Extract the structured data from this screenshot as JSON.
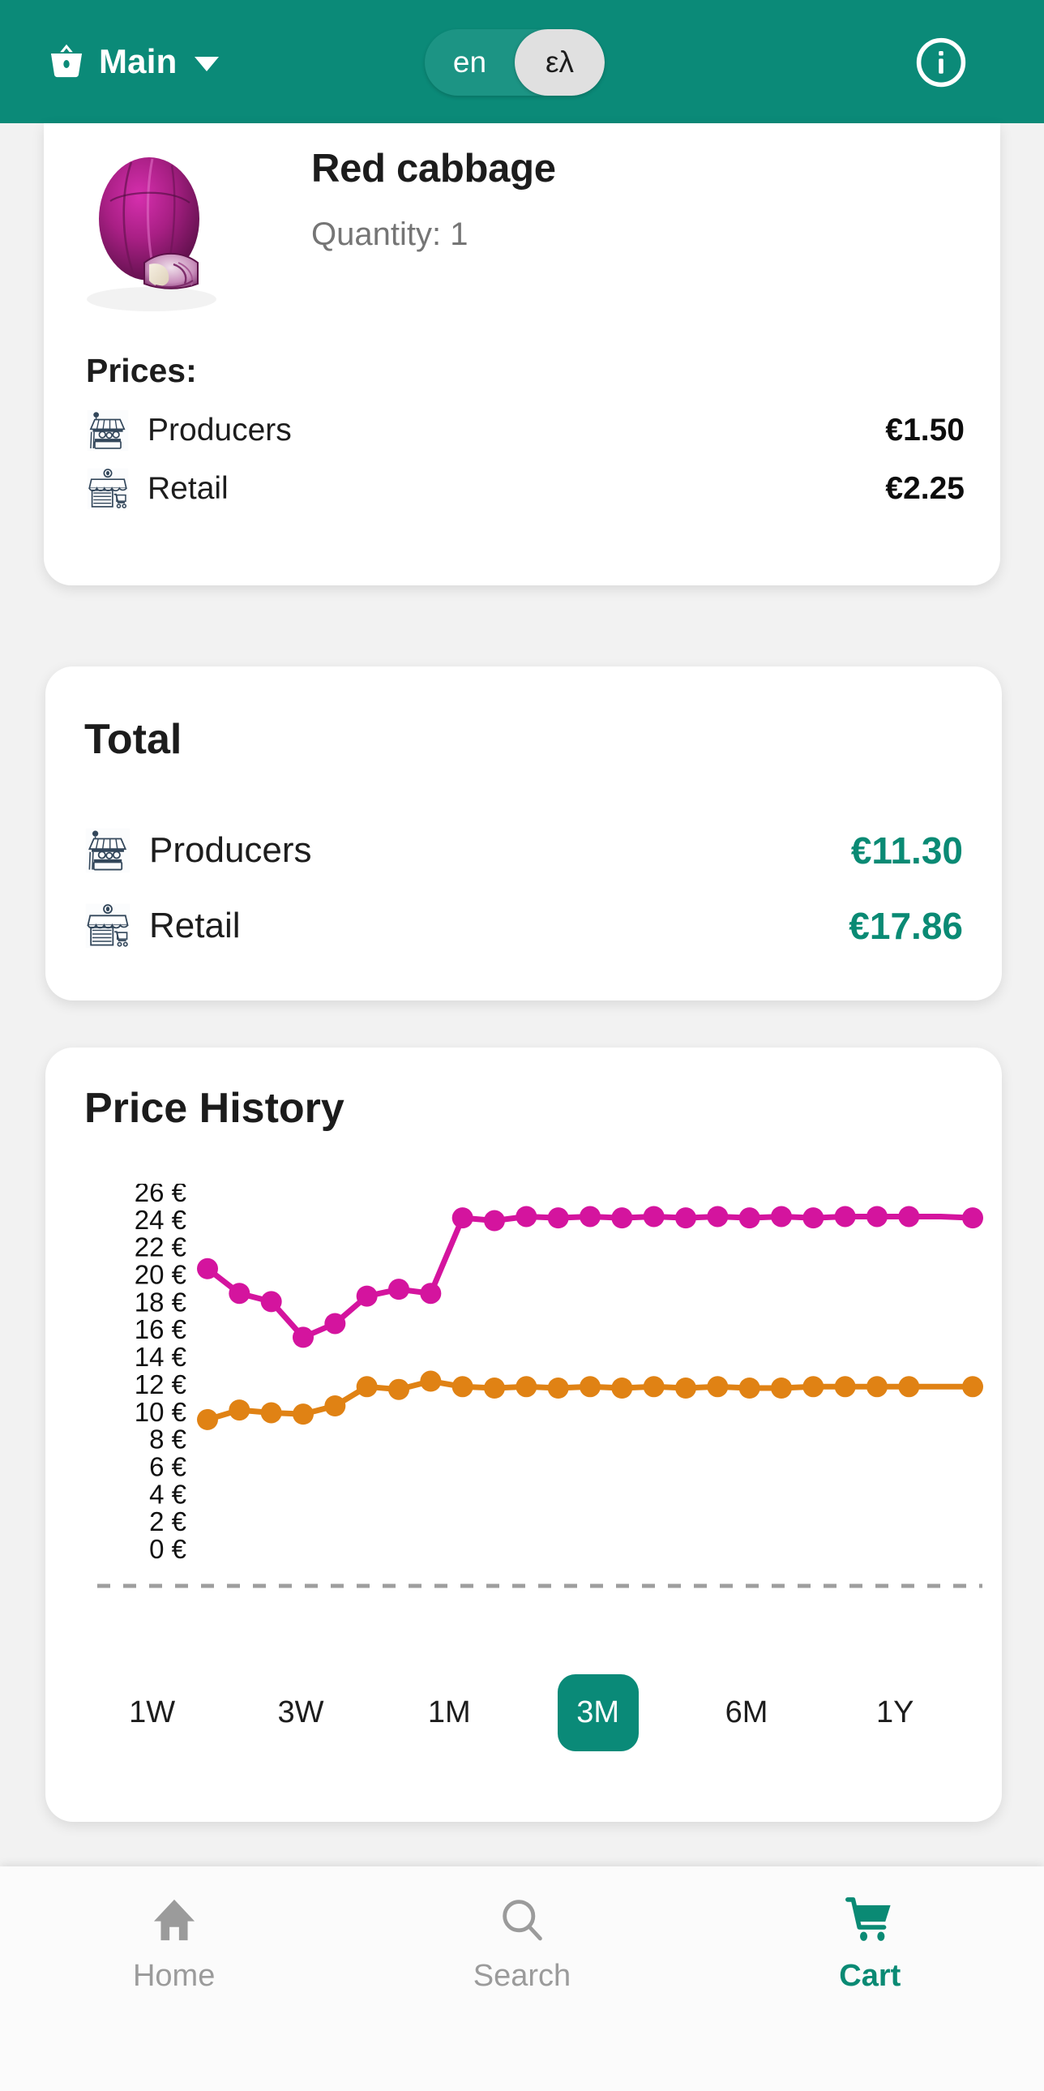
{
  "header": {
    "basket_icon": "basket-icon",
    "title": "Main",
    "dropdown_icon": "chevron-down-icon",
    "lang": {
      "options": [
        "en",
        "ελ"
      ],
      "selected": "ελ"
    },
    "info_icon": "info-circle-icon"
  },
  "product": {
    "image_alt": "red-cabbage-photo",
    "name": "Red cabbage",
    "quantity_label": "Quantity: 1",
    "prices_heading": "Prices:",
    "rows": [
      {
        "icon": "market-stall-icon",
        "label": "Producers",
        "value": "€1.50"
      },
      {
        "icon": "storefront-icon",
        "label": "Retail",
        "value": "€2.25"
      }
    ]
  },
  "total": {
    "title": "Total",
    "rows": [
      {
        "icon": "market-stall-icon",
        "label": "Producers",
        "value": "€11.30"
      },
      {
        "icon": "storefront-icon",
        "label": "Retail",
        "value": "€17.86"
      }
    ]
  },
  "price_history": {
    "title": "Price History",
    "ranges": [
      "1W",
      "3W",
      "1M",
      "3M",
      "6M",
      "1Y"
    ],
    "selected_range": "3M"
  },
  "chart_data": {
    "type": "line",
    "title": "Price History",
    "xlabel": "",
    "ylabel": "",
    "ylim": [
      0,
      26
    ],
    "yticks": [
      0,
      2,
      4,
      6,
      8,
      10,
      12,
      14,
      16,
      18,
      20,
      22,
      24,
      26
    ],
    "ytick_labels": [
      "0 €",
      "2 €",
      "4 €",
      "6 €",
      "8 €",
      "10 €",
      "12 €",
      "14 €",
      "16 €",
      "18 €",
      "20 €",
      "22 €",
      "24 €",
      "26 €"
    ],
    "grid": false,
    "legend_position": "none",
    "baseline_dashed": true,
    "x": [
      1,
      2,
      3,
      4,
      5,
      6,
      7,
      8,
      9,
      10,
      11,
      12,
      13,
      14,
      15,
      16,
      17,
      18,
      19,
      20,
      21,
      22,
      23,
      24,
      25
    ],
    "series": [
      {
        "name": "Retail",
        "color": "#d4149e",
        "values": [
          20.4,
          18.6,
          18.0,
          15.4,
          16.4,
          18.4,
          18.9,
          18.6,
          24.1,
          23.9,
          24.2,
          24.1,
          24.2,
          24.1,
          24.2,
          24.1,
          24.2,
          24.1,
          24.2,
          24.1,
          24.2,
          24.2,
          24.2,
          24.2,
          24.1
        ]
      },
      {
        "name": "Producers",
        "color": "#e08214",
        "values": [
          9.4,
          10.1,
          9.9,
          9.8,
          10.4,
          11.8,
          11.6,
          12.2,
          11.8,
          11.7,
          11.8,
          11.7,
          11.8,
          11.7,
          11.8,
          11.7,
          11.8,
          11.7,
          11.7,
          11.8,
          11.8,
          11.8,
          11.8,
          11.8,
          11.8
        ]
      }
    ]
  },
  "bottom_nav": {
    "items": [
      {
        "icon": "home-icon",
        "label": "Home",
        "active": false
      },
      {
        "icon": "search-icon",
        "label": "Search",
        "active": false
      },
      {
        "icon": "cart-icon",
        "label": "Cart",
        "active": true
      }
    ]
  },
  "colors": {
    "brand_teal": "#0b8a78",
    "accent_green": "#0a8a74",
    "series_retail": "#d4149e",
    "series_producers": "#e08214",
    "muted_text": "#9b9b9b"
  }
}
